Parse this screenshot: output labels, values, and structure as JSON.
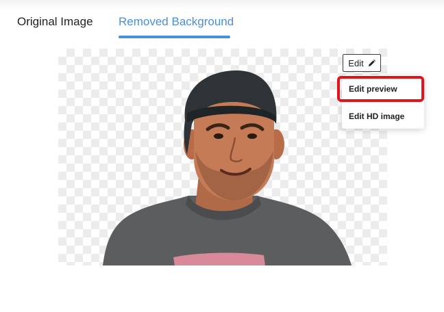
{
  "tabs": {
    "original_label": "Original Image",
    "removed_label": "Removed Background",
    "active": "Removed Background"
  },
  "colors": {
    "accent": "#4a8fde",
    "highlight": "#e0141b"
  },
  "image": {
    "icon": "person-photo"
  },
  "edit": {
    "button_label": "Edit",
    "button_icon": "pencil-icon",
    "menu": [
      {
        "label": "Edit preview",
        "highlighted": true
      },
      {
        "label": "Edit HD image",
        "highlighted": false
      }
    ]
  }
}
